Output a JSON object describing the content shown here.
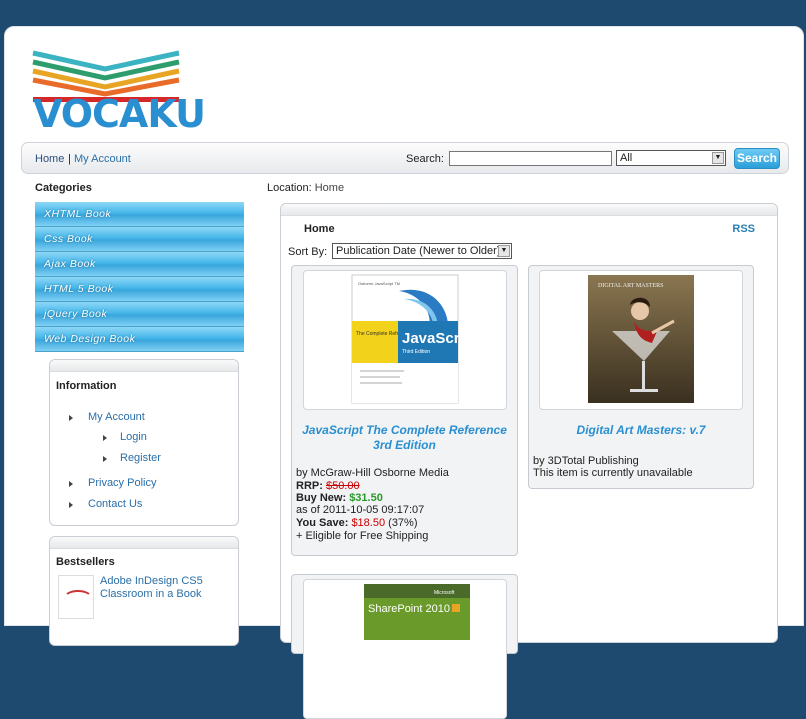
{
  "site": {
    "logo_text": "VOCAKU",
    "colors": {
      "brand_blue": "#2a8fd0",
      "link": "#2a6fa8",
      "frame_bg": "#1d4a6e",
      "category_blue": "#46b7ea"
    }
  },
  "nav": {
    "home": "Home",
    "separator": "|",
    "my_account": "My Account",
    "search_label": "Search:",
    "search_value": "",
    "search_scope": "All",
    "search_button": "Search"
  },
  "categories": {
    "title": "Categories",
    "items": [
      "XHTML Book",
      "Css Book",
      "Ajax Book",
      "HTML 5 Book",
      "jQuery Book",
      "Web Design Book"
    ]
  },
  "information": {
    "title": "Information",
    "my_account": "My Account",
    "login": "Login",
    "register": "Register",
    "privacy": "Privacy Policy",
    "contact": "Contact Us"
  },
  "bestsellers": {
    "title": "Bestsellers",
    "item": "Adobe InDesign CS5 Classroom in a Book"
  },
  "location": {
    "label": "Location:",
    "value": "Home"
  },
  "main": {
    "title": "Home",
    "rss": "RSS",
    "sort_label": "Sort By:",
    "sort_value": "Publication Date (Newer to Older)"
  },
  "products": [
    {
      "title": "JavaScript The Complete Reference 3rd Edition",
      "by": "by McGraw-Hill Osborne Media",
      "rrp_label": "RRP:",
      "rrp": "$50.00",
      "buy_label": "Buy New:",
      "buy": "$31.50",
      "asof": "as of 2011-10-05 09:17:07",
      "save_label": "You Save:",
      "save": "$18.50",
      "save_pct": "(37%)",
      "shipping": "+ Eligible for Free Shipping",
      "cover": {
        "series": "Osborne JavaScript TM",
        "subtitle": "The Complete Reference",
        "title": "JavaScript",
        "edition": "Third Edition"
      }
    },
    {
      "title": "Digital Art Masters: v.7",
      "by": "by 3DTotal Publishing",
      "availability": "This item is currently unavailable",
      "cover": {
        "title": "DIGITAL ART MASTERS"
      }
    },
    {
      "cover": {
        "brand": "Microsoft",
        "title": "SharePoint 2010"
      }
    }
  ]
}
